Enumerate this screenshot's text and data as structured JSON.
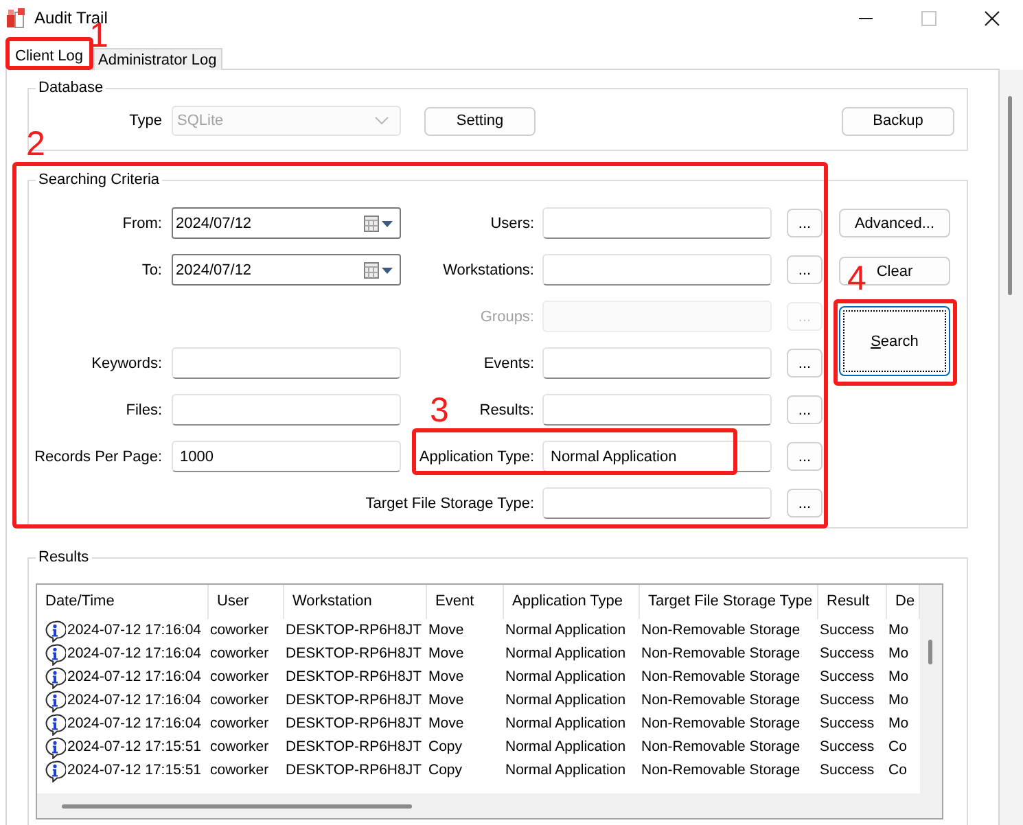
{
  "window": {
    "title": "Audit Trail",
    "controls": [
      {
        "kind": "minimize",
        "disabled": false
      },
      {
        "kind": "maximize",
        "disabled": true
      },
      {
        "kind": "close",
        "disabled": false
      }
    ]
  },
  "tabs": [
    {
      "label": "Client Log",
      "selected": true,
      "annotation": "1"
    },
    {
      "label": "Administrator Log",
      "selected": false
    }
  ],
  "database": {
    "title": "Database",
    "type_label": "Type",
    "type_value": "SQLite",
    "type_disabled": true,
    "buttons": [
      "Setting",
      "Backup"
    ]
  },
  "criteria": {
    "title": "Searching Criteria",
    "annotation": "2",
    "rows": [
      {
        "left": {
          "kind": "date",
          "label": "From:",
          "value": "2024/07/12"
        },
        "right": {
          "label": "Users:",
          "disabled": false,
          "button": "..."
        }
      },
      {
        "left": {
          "kind": "date",
          "label": "To:",
          "value": "2024/07/12"
        },
        "right": {
          "label": "Workstations:",
          "disabled": false,
          "button": "..."
        }
      },
      {
        "right": {
          "label": "Groups:",
          "disabled": true,
          "button": "..."
        }
      },
      {
        "left": {
          "kind": "text",
          "label": "Keywords:"
        },
        "right": {
          "label": "Events:",
          "disabled": false,
          "button": "..."
        }
      },
      {
        "left": {
          "kind": "text",
          "label": "Files:"
        },
        "right": {
          "label": "Results:",
          "disabled": false,
          "button": "..."
        }
      },
      {
        "left": {
          "kind": "text",
          "label": "Records Per Page:",
          "value": "1000"
        },
        "right": {
          "label": "Application Type:",
          "value": "Normal Application",
          "disabled": false,
          "button": "...",
          "annotation": "3"
        }
      },
      {
        "right": {
          "label": "Target File Storage Type:",
          "disabled": false,
          "button": "..."
        }
      }
    ],
    "buttons": [
      {
        "label_parts": [
          {
            "text": "Advanced...",
            "underlined": false
          }
        ],
        "focused": false
      },
      {
        "label_parts": [
          {
            "text": "Clear",
            "underlined": false
          }
        ],
        "focused": false
      },
      {
        "label_parts": [
          {
            "text": "S",
            "underlined": true
          },
          {
            "text": "earch",
            "underlined": false
          }
        ],
        "focused": true,
        "annotation": "4"
      }
    ]
  },
  "results": {
    "title": "Results",
    "columns": [
      "Date/Time",
      "User",
      "Workstation",
      "Event",
      "Application Type",
      "Target File Storage Type",
      "Result",
      "De"
    ],
    "rows": [
      {
        "cells": [
          "2024-07-12 17:16:04",
          "coworker",
          "DESKTOP-RP6H8JT",
          "Move",
          "Normal Application",
          "Non-Removable Storage",
          "Success",
          "Mo"
        ]
      },
      {
        "cells": [
          "2024-07-12 17:16:04",
          "coworker",
          "DESKTOP-RP6H8JT",
          "Move",
          "Normal Application",
          "Non-Removable Storage",
          "Success",
          "Mo"
        ]
      },
      {
        "cells": [
          "2024-07-12 17:16:04",
          "coworker",
          "DESKTOP-RP6H8JT",
          "Move",
          "Normal Application",
          "Non-Removable Storage",
          "Success",
          "Mo"
        ]
      },
      {
        "cells": [
          "2024-07-12 17:16:04",
          "coworker",
          "DESKTOP-RP6H8JT",
          "Move",
          "Normal Application",
          "Non-Removable Storage",
          "Success",
          "Mo"
        ]
      },
      {
        "cells": [
          "2024-07-12 17:16:04",
          "coworker",
          "DESKTOP-RP6H8JT",
          "Move",
          "Normal Application",
          "Non-Removable Storage",
          "Success",
          "Mo"
        ]
      },
      {
        "cells": [
          "2024-07-12 17:15:51",
          "coworker",
          "DESKTOP-RP6H8JT",
          "Copy",
          "Normal Application",
          "Non-Removable Storage",
          "Success",
          "Co"
        ]
      },
      {
        "cells": [
          "2024-07-12 17:15:51",
          "coworker",
          "DESKTOP-RP6H8JT",
          "Copy",
          "Normal Application",
          "Non-Removable Storage",
          "Success",
          "Co"
        ]
      }
    ]
  }
}
